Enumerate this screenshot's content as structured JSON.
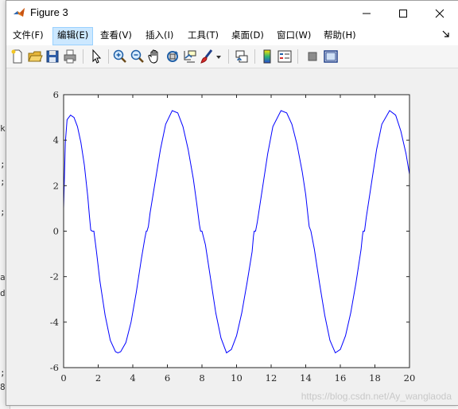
{
  "window": {
    "title": "Figure 3"
  },
  "menu": {
    "items": [
      {
        "label": "文件(F)"
      },
      {
        "label": "编辑(E)"
      },
      {
        "label": "查看(V)"
      },
      {
        "label": "插入(I)"
      },
      {
        "label": "工具(T)"
      },
      {
        "label": "桌面(D)"
      },
      {
        "label": "窗口(W)"
      },
      {
        "label": "帮助(H)"
      }
    ],
    "active_index": 1
  },
  "toolbar": {
    "buttons": [
      "new-figure-icon",
      "open-file-icon",
      "save-icon",
      "print-icon",
      "pointer-icon",
      "zoom-in-icon",
      "zoom-out-icon",
      "pan-hand-icon",
      "rotate-3d-icon",
      "data-cursor-icon",
      "brush-icon",
      "brush-dropdown-icon",
      "link-plot-icon",
      "colorbar-icon",
      "legend-icon",
      "hide-plot-tools-icon",
      "show-plot-tools-icon"
    ]
  },
  "background_editor": {
    "chars": [
      "k",
      ";",
      ";",
      ";",
      "a",
      "d",
      ";",
      "8"
    ]
  },
  "watermark": "https://blog.csdn.net/Ay_wanglaoda",
  "chart_data": {
    "type": "line",
    "title": "",
    "xlabel": "",
    "ylabel": "",
    "xlim": [
      0,
      20
    ],
    "ylim": [
      -6,
      6
    ],
    "xticks": [
      "0",
      "2",
      "4",
      "6",
      "8",
      "10",
      "12",
      "14",
      "16",
      "18",
      "20"
    ],
    "yticks": [
      "6",
      "4",
      "2",
      "0",
      "-2",
      "-4",
      "-6"
    ],
    "grid": false,
    "line_color": "#0000ff",
    "series": [
      {
        "x": [
          0,
          0.1,
          0.2,
          0.4,
          0.6,
          0.8,
          1.0,
          1.2,
          1.4,
          1.5,
          1.57,
          1.65,
          1.75,
          1.9,
          2.1,
          2.4,
          2.7,
          3.0,
          3.14,
          3.3,
          3.6,
          3.9,
          4.2,
          4.5,
          4.7,
          4.78,
          4.82,
          4.9,
          5.0,
          5.3,
          5.6,
          5.9,
          6.28,
          6.6,
          6.9,
          7.2,
          7.5,
          7.7,
          7.85,
          7.92,
          8.0,
          8.2,
          8.5,
          8.8,
          9.1,
          9.42,
          9.7,
          10.0,
          10.3,
          10.6,
          10.9,
          10.98,
          11.02,
          11.1,
          11.2,
          11.5,
          11.8,
          12.1,
          12.57,
          12.9,
          13.2,
          13.5,
          13.8,
          14.0,
          14.14,
          14.2,
          14.3,
          14.5,
          14.8,
          15.1,
          15.4,
          15.71,
          16.0,
          16.3,
          16.6,
          16.9,
          17.2,
          17.28,
          17.32,
          17.4,
          17.5,
          17.8,
          18.1,
          18.4,
          18.85,
          19.2,
          19.5,
          19.8,
          20.0
        ],
        "y": [
          1.0,
          3.9,
          4.9,
          5.1,
          5.0,
          4.6,
          3.9,
          2.9,
          1.5,
          0.6,
          0.05,
          0.0,
          0.0,
          -0.9,
          -2.2,
          -3.7,
          -4.8,
          -5.3,
          -5.35,
          -5.3,
          -4.9,
          -4.0,
          -2.7,
          -1.2,
          -0.3,
          0.0,
          0.0,
          0.2,
          0.8,
          2.2,
          3.6,
          4.7,
          5.3,
          5.2,
          4.6,
          3.6,
          2.3,
          1.2,
          0.3,
          0.0,
          0.0,
          -0.6,
          -2.1,
          -3.6,
          -4.7,
          -5.35,
          -5.2,
          -4.6,
          -3.6,
          -2.3,
          -0.9,
          -0.2,
          0.0,
          0.0,
          0.4,
          1.9,
          3.4,
          4.6,
          5.3,
          5.2,
          4.7,
          3.8,
          2.6,
          1.6,
          0.6,
          0.2,
          0.0,
          -0.8,
          -2.3,
          -3.7,
          -4.8,
          -5.35,
          -5.2,
          -4.6,
          -3.6,
          -2.3,
          -0.8,
          -0.2,
          0.0,
          0.0,
          0.6,
          2.1,
          3.6,
          4.7,
          5.3,
          5.1,
          4.4,
          3.4,
          2.5
        ]
      }
    ]
  }
}
